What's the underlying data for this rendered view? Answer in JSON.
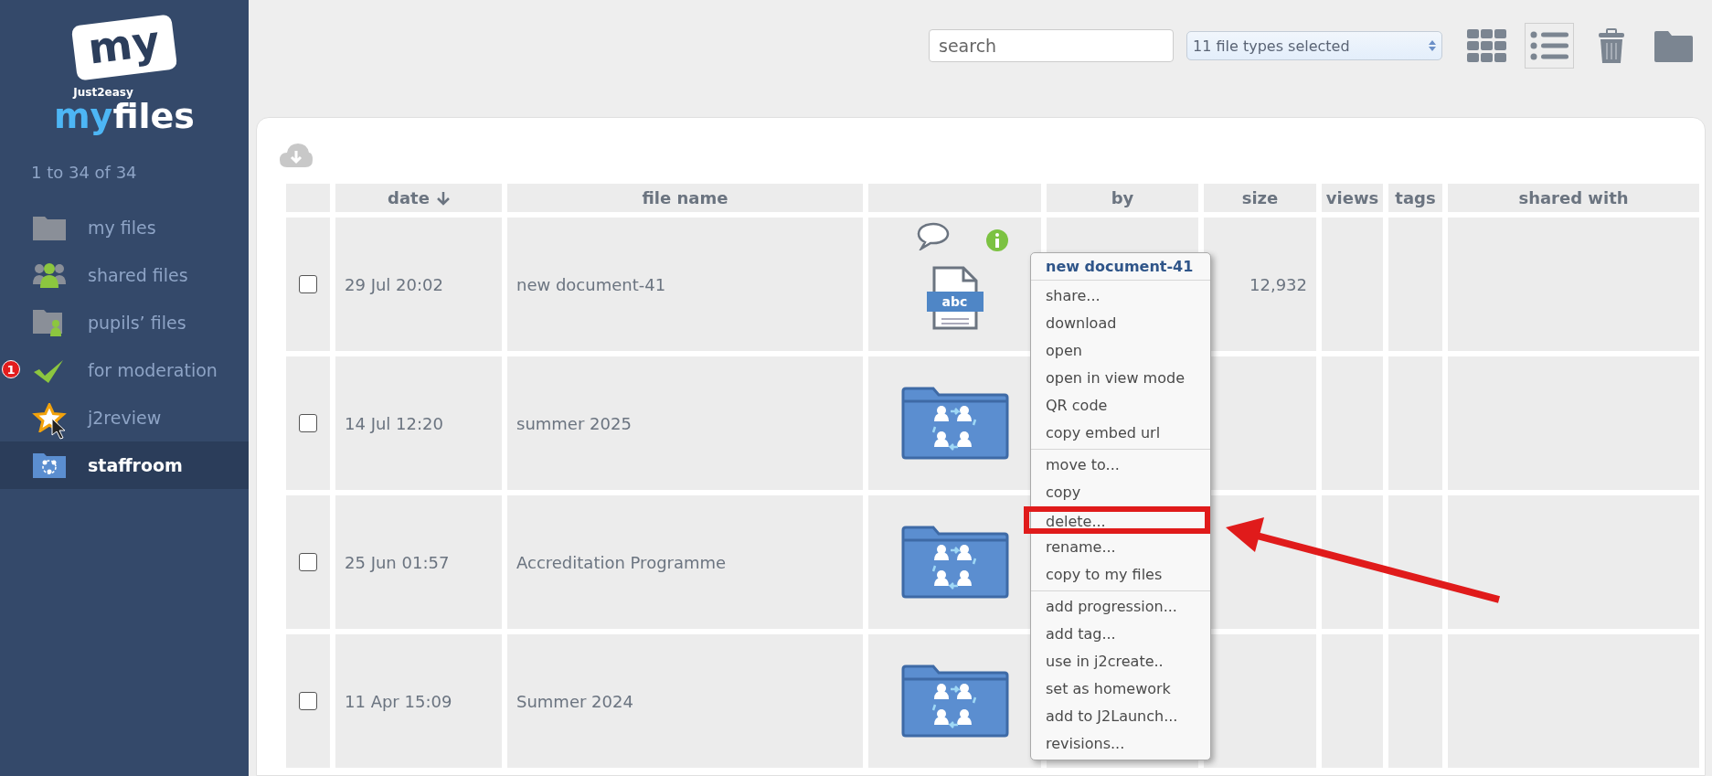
{
  "sidebar": {
    "logo": {
      "badge": "my",
      "tagline": "Just2easy",
      "name_part_1": "my",
      "name_part_2": "files"
    },
    "count": "1 to 34 of 34",
    "items": [
      {
        "label": "my files",
        "kind": "folder",
        "selected": false
      },
      {
        "label": "shared files",
        "kind": "people",
        "selected": false
      },
      {
        "label": "pupils’ files",
        "kind": "pupil",
        "selected": false
      },
      {
        "label": "for moderation",
        "kind": "check",
        "selected": false,
        "badge": "1"
      },
      {
        "label": "j2review",
        "kind": "star",
        "selected": false,
        "cursor": true
      },
      {
        "label": "staffroom",
        "kind": "shared",
        "selected": true
      }
    ]
  },
  "toolbar": {
    "search": {
      "placeholder": "search"
    },
    "file_types": "11 file types selected",
    "views": [
      {
        "kind": "grid",
        "selected": false
      },
      {
        "kind": "list",
        "selected": true
      }
    ],
    "actions": [
      {
        "kind": "trash"
      },
      {
        "kind": "folder"
      }
    ]
  },
  "table": {
    "columns": [
      {
        "kind": "checkbox"
      },
      {
        "kind": "text",
        "label": "date",
        "sorted": true
      },
      {
        "kind": "text",
        "label": "file name"
      },
      {
        "kind": "icon"
      },
      {
        "kind": "text",
        "label": "by"
      },
      {
        "kind": "text",
        "label": "size"
      },
      {
        "kind": "text",
        "label": "views"
      },
      {
        "kind": "text",
        "label": "tags"
      },
      {
        "kind": "text",
        "label": "shared with"
      }
    ],
    "rows": [
      {
        "checked": false,
        "date": "29 Jul 20:02",
        "name": "new document-41",
        "kind": "document",
        "badge": "abc",
        "comment": true,
        "info": true,
        "size": "12,932"
      },
      {
        "checked": false,
        "date": "14 Jul 12:20",
        "name": "summer 2025",
        "kind": "shared",
        "comment": false,
        "info": false
      },
      {
        "checked": false,
        "date": "25 Jun 01:57",
        "name": "Accreditation Programme",
        "kind": "shared",
        "comment": false,
        "info": false
      },
      {
        "checked": false,
        "date": "11 Apr 15:09",
        "name": "Summer 2024",
        "kind": "shared",
        "comment": false,
        "info": false
      }
    ]
  },
  "context_menu": {
    "title": "new document-41",
    "groups": [
      [
        {
          "label": "share...",
          "highlighted": false
        },
        {
          "label": "download",
          "highlighted": false
        },
        {
          "label": "open",
          "highlighted": false
        },
        {
          "label": "open in view mode",
          "highlighted": false
        },
        {
          "label": "QR code",
          "highlighted": false
        },
        {
          "label": "copy embed url",
          "highlighted": false
        }
      ],
      [
        {
          "label": "move to...",
          "highlighted": false
        },
        {
          "label": "copy",
          "highlighted": false
        },
        {
          "label": "delete...",
          "highlighted": true
        },
        {
          "label": "rename...",
          "highlighted": false
        },
        {
          "label": "copy to my files",
          "highlighted": false
        }
      ],
      [
        {
          "label": "add progression...",
          "highlighted": false
        },
        {
          "label": "add tag...",
          "highlighted": false
        },
        {
          "label": "use in j2create..",
          "highlighted": false
        },
        {
          "label": "set as homework",
          "highlighted": false
        },
        {
          "label": "add to J2Launch...",
          "highlighted": false
        },
        {
          "label": "revisions...",
          "highlighted": false
        }
      ]
    ]
  }
}
